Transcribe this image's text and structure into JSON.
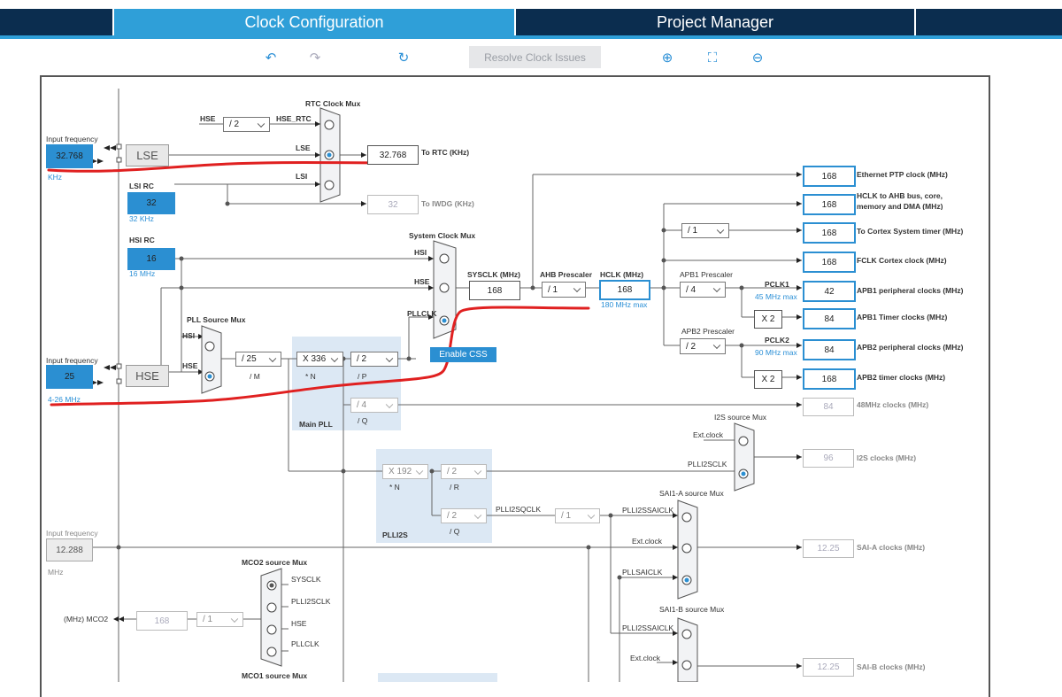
{
  "tabs": [
    {
      "label": "Clock Configuration"
    },
    {
      "label": "Project Manager"
    }
  ],
  "toolbar": {
    "undo_icon": "undo-icon",
    "redo_icon": "redo-icon",
    "reset_icon": "reset-icon",
    "resolve_label": "Resolve Clock Issues",
    "zoom_in_icon": "zoom-in-icon",
    "fit_icon": "fit-icon",
    "zoom_out_icon": "zoom-out-icon"
  },
  "colors": {
    "accent": "#2b8fd2",
    "tab_active": "#2f9fd8",
    "tab_dark": "#0b2d4f",
    "annotation": "#e02020"
  },
  "diagram": {
    "lse": {
      "label_input": "Input frequency",
      "value": "32.768",
      "unit": "KHz",
      "box": "LSE"
    },
    "lsirc": {
      "title": "LSI RC",
      "value": "32",
      "note": "32 KHz"
    },
    "hsirc": {
      "title": "HSI RC",
      "value": "16",
      "note": "16 MHz"
    },
    "hse": {
      "label_input": "Input frequency",
      "value": "25",
      "range": "4-26 MHz",
      "box": "HSE"
    },
    "ext_input": {
      "label_input": "Input frequency",
      "value": "12.288",
      "unit": "MHz"
    },
    "rtc_mux": {
      "title": "RTC Clock Mux",
      "hse": "HSE",
      "div": "/ 2",
      "hse_rtc": "HSE_RTC",
      "lse": "LSE",
      "lsi": "LSI",
      "out_value": "32.768",
      "out_label": "To RTC (KHz)",
      "iwdg_value": "32",
      "iwdg_label": "To IWDG (KHz)"
    },
    "sys_mux": {
      "title": "System Clock Mux",
      "hsi": "HSI",
      "hse": "HSE",
      "pllclk": "PLLCLK",
      "css": "Enable CSS"
    },
    "pll_mux": {
      "title": "PLL Source Mux",
      "hsi": "HSI",
      "hse": "HSE"
    },
    "main_pll": {
      "title": "Main PLL",
      "m": "/ 25",
      "m_lbl": "/ M",
      "n": "X 336",
      "n_lbl": "* N",
      "p": "/ 2",
      "p_lbl": "/ P",
      "q": "/ 4",
      "q_lbl": "/ Q"
    },
    "sysclk": {
      "label": "SYSCLK (MHz)",
      "value": "168"
    },
    "ahb": {
      "label": "AHB Prescaler",
      "value": "/ 1"
    },
    "hclk": {
      "label": "HCLK (MHz)",
      "value": "168",
      "max": "180 MHz max"
    },
    "apb1": {
      "label": "APB1 Prescaler",
      "value": "/ 4",
      "pclk": "PCLK1",
      "max": "45 MHz max",
      "x2": "X 2"
    },
    "apb2": {
      "label": "APB2 Prescaler",
      "value": "/ 2",
      "pclk": "PCLK2",
      "max": "90 MHz max",
      "x2": "X 2"
    },
    "cortex_div": "/ 1",
    "outputs": [
      {
        "value": "168",
        "label": "Ethernet PTP clock (MHz)"
      },
      {
        "value": "168",
        "label": "HCLK to AHB bus, core,",
        "label2": "memory and DMA (MHz)"
      },
      {
        "value": "168",
        "label": "To Cortex System timer (MHz)"
      },
      {
        "value": "168",
        "label": "FCLK Cortex clock (MHz)"
      },
      {
        "value": "42",
        "label": "APB1 peripheral clocks (MHz)"
      },
      {
        "value": "84",
        "label": "APB1 Timer clocks (MHz)"
      },
      {
        "value": "84",
        "label": "APB2 peripheral clocks (MHz)"
      },
      {
        "value": "168",
        "label": "APB2 timer clocks (MHz)"
      }
    ],
    "mhz48": {
      "value": "84",
      "label": "48MHz clocks (MHz)"
    },
    "i2s_mux": {
      "title": "I2S source Mux",
      "ext": "Ext.clock",
      "plli2s": "PLLI2SCLK",
      "value": "96",
      "label": "I2S clocks (MHz)"
    },
    "plli2s": {
      "title": "PLLI2S",
      "n": "X 192",
      "n_lbl": "* N",
      "r": "/ 2",
      "r_lbl": "/ R",
      "q": "/ 2",
      "q_lbl": "/ Q",
      "qclk": "PLLI2SQCLK",
      "div": "/ 1"
    },
    "saia_mux": {
      "title": "SAI1-A source Mux",
      "i2ssai": "PLLI2SSAICLK",
      "ext": "Ext.clock",
      "pllsai": "PLLSAICLK",
      "value": "12.25",
      "label": "SAI-A clocks (MHz)"
    },
    "saib_mux": {
      "title": "SAI1-B source Mux",
      "i2ssai": "PLLI2SSAICLK",
      "ext": "Ext.clock",
      "value": "12.25",
      "label": "SAI-B clocks (MHz)"
    },
    "mco2": {
      "title": "MCO2 source Mux",
      "sysclk": "SYSCLK",
      "plli2s": "PLLI2SCLK",
      "hse": "HSE",
      "pllclk": "PLLCLK",
      "out_label": "(MHz) MCO2",
      "value": "168",
      "div": "/ 1"
    },
    "mco1": {
      "title": "MCO1 source Mux"
    }
  }
}
